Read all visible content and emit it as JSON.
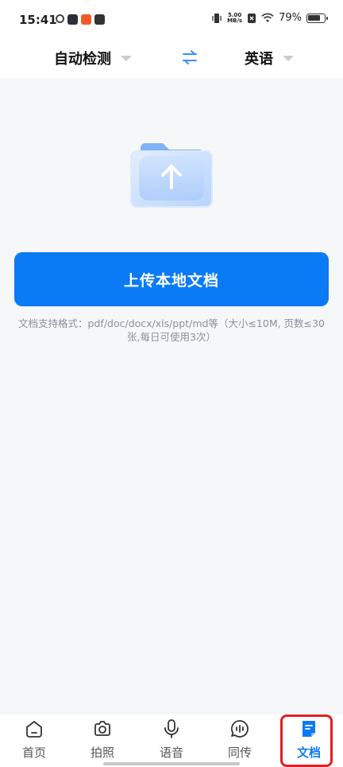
{
  "status_bar": {
    "time": "15:41",
    "net_speed_value": "5.00",
    "net_speed_unit": "MB/s",
    "battery_percent": "79%",
    "battery_level": 0.79
  },
  "language_bar": {
    "source_language": "自动检测",
    "target_language": "英语"
  },
  "main": {
    "upload_button_label": "上传本地文档",
    "format_hint": "文档支持格式：pdf/doc/docx/xls/ppt/md等（大小≤10M, 页数≤30张,每日可使用3次）"
  },
  "bottom_nav": {
    "items": [
      {
        "label": "首页",
        "icon": "home-icon"
      },
      {
        "label": "拍照",
        "icon": "camera-icon"
      },
      {
        "label": "语音",
        "icon": "microphone-icon"
      },
      {
        "label": "同传",
        "icon": "chat-voice-icon"
      },
      {
        "label": "文档",
        "icon": "document-icon",
        "active": true
      }
    ]
  },
  "colors": {
    "accent": "#0a7bf5",
    "highlight_frame": "#e02020",
    "background": "#f6f7f9"
  }
}
